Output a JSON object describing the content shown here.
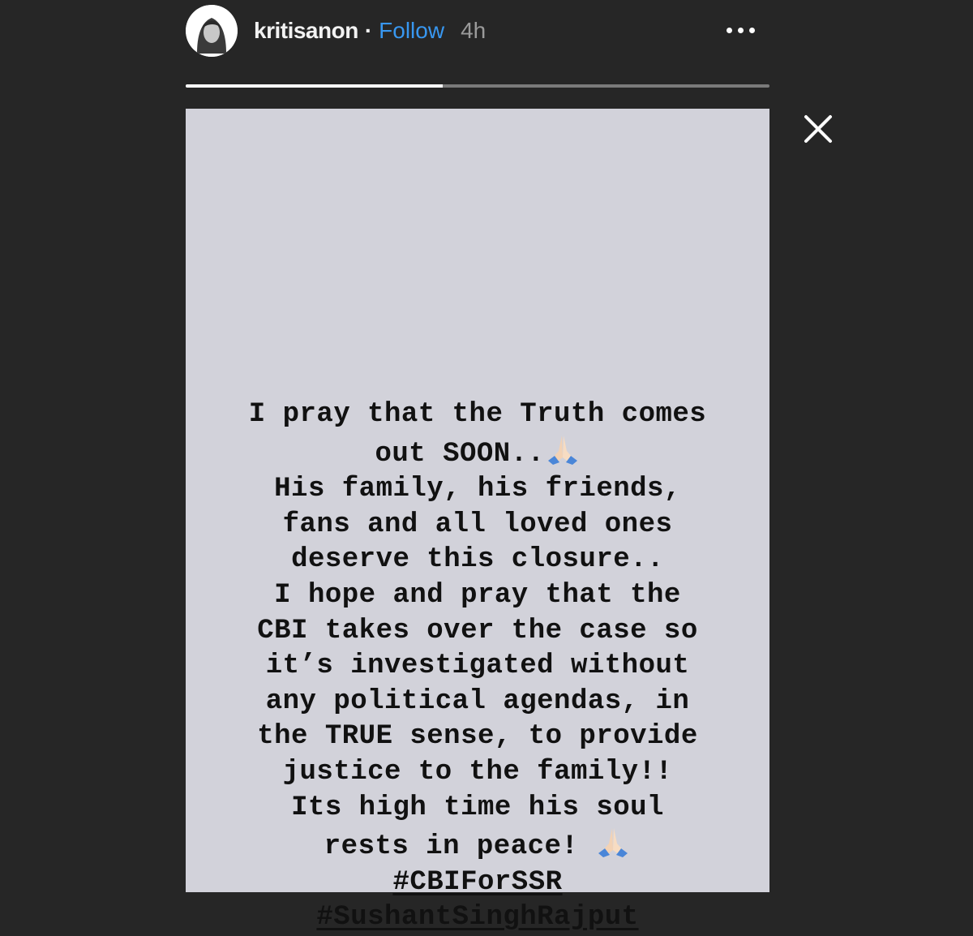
{
  "header": {
    "username": "kritisanon",
    "separator": "·",
    "follow_label": "Follow",
    "time": "4h",
    "more_icon": "more-horizontal-icon"
  },
  "progress": {
    "fraction": 0.44
  },
  "story": {
    "lines": [
      "I pray that the Truth comes",
      "out SOON..",
      "His family, his friends,",
      "fans and all loved ones",
      "deserve this closure..",
      "I hope and pray that the",
      "CBI takes over the case so",
      "it’s investigated without",
      "any political agendas, in",
      "the TRUE sense, to provide",
      "justice to the family!!",
      "Its high time his soul",
      "rests in peace! "
    ],
    "hashtags": [
      "#CBIForSSR",
      "#SushantSinghRajput"
    ],
    "emoji_icon": "folded-hands-emoji"
  },
  "colors": {
    "background": "#262626",
    "story_background": "#d2d2da",
    "follow": "#3897f0",
    "text": "#111111"
  }
}
